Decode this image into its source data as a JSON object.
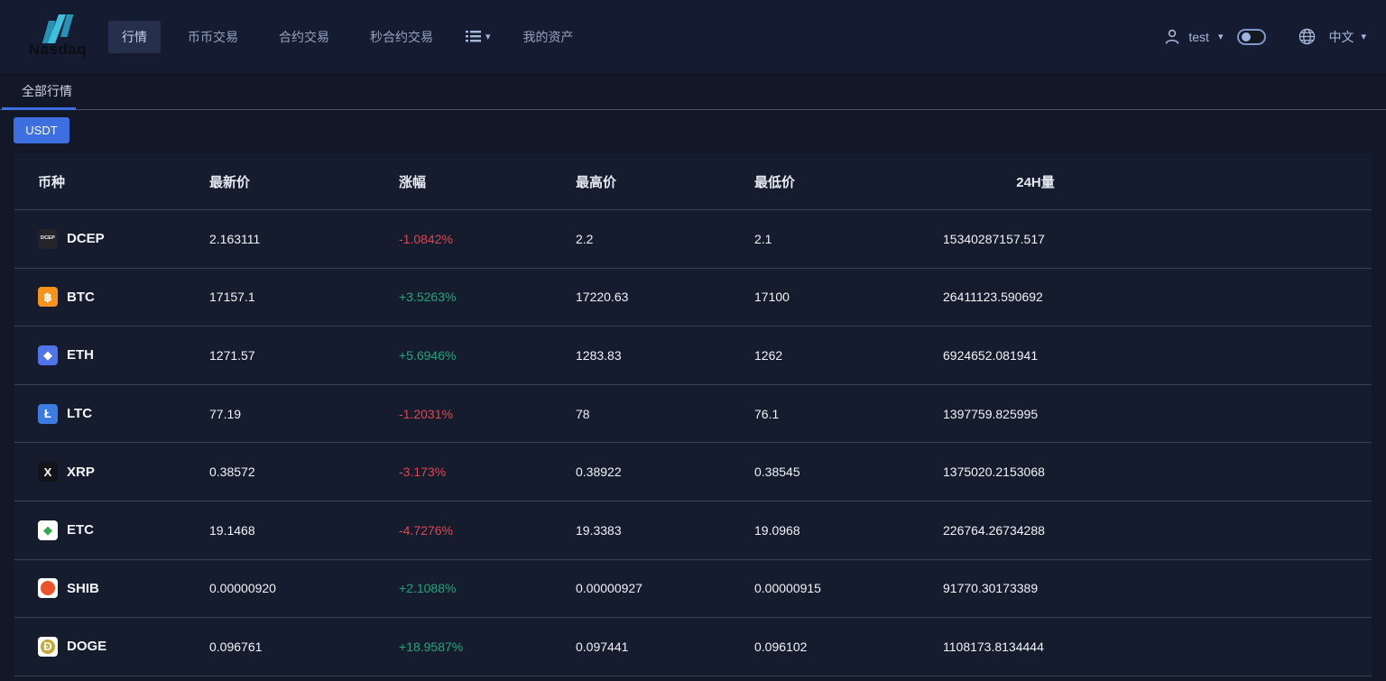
{
  "brand": {
    "name": "Nasdaq"
  },
  "navbar": {
    "items": [
      {
        "label": "行情",
        "active": true
      },
      {
        "label": "币币交易",
        "active": false
      },
      {
        "label": "合约交易",
        "active": false
      },
      {
        "label": "秒合约交易",
        "active": false
      },
      {
        "label": "我的资产",
        "active": false
      }
    ],
    "caret": "▾",
    "user": {
      "name": "test"
    },
    "language": "中文"
  },
  "tabs": {
    "active": "全部行情"
  },
  "filters": {
    "usdt_label": "USDT"
  },
  "market_table": {
    "columns": [
      "币种",
      "最新价",
      "涨幅",
      "最高价",
      "最低价",
      "24H量"
    ],
    "rows": [
      {
        "symbol": "DCEP",
        "last": "2.163111",
        "change": "-1.0842%",
        "direction": "down",
        "high": "2.2",
        "low": "2.1",
        "volume": "15340287157.517",
        "icon": {
          "bg": "#232329",
          "glyph": "DCEP",
          "fg": "#ffffff",
          "tiny": true
        }
      },
      {
        "symbol": "BTC",
        "last": "17157.1",
        "change": "+3.5263%",
        "direction": "up",
        "high": "17220.63",
        "low": "17100",
        "volume": "26411123.590692",
        "icon": {
          "bg": "#f7931a",
          "glyph": "฿",
          "fg": "#ffffff"
        }
      },
      {
        "symbol": "ETH",
        "last": "1271.57",
        "change": "+5.6946%",
        "direction": "up",
        "high": "1283.83",
        "low": "1262",
        "volume": "6924652.081941",
        "icon": {
          "bg": "#4f74e8",
          "glyph": "◆",
          "fg": "#ffffff"
        }
      },
      {
        "symbol": "LTC",
        "last": "77.19",
        "change": "-1.2031%",
        "direction": "down",
        "high": "78",
        "low": "76.1",
        "volume": "1397759.825995",
        "icon": {
          "bg": "#3c7ce0",
          "glyph": "Ł",
          "fg": "#ffffff"
        }
      },
      {
        "symbol": "XRP",
        "last": "0.38572",
        "change": "-3.173%",
        "direction": "down",
        "high": "0.38922",
        "low": "0.38545",
        "volume": "1375020.2153068",
        "icon": {
          "bg": "#121419",
          "glyph": "X",
          "fg": "#ffffff"
        }
      },
      {
        "symbol": "ETC",
        "last": "19.1468",
        "change": "-4.7276%",
        "direction": "down",
        "high": "19.3383",
        "low": "19.0968",
        "volume": "226764.26734288",
        "icon": {
          "bg": "#ffffff",
          "glyph": "◆",
          "fg": "#2faa4e"
        }
      },
      {
        "symbol": "SHIB",
        "last": "0.00000920",
        "change": "+2.1088%",
        "direction": "up",
        "high": "0.00000927",
        "low": "0.00000915",
        "volume": "91770.30173389",
        "icon": {
          "bg": "#ffffff",
          "glyph": "",
          "fg": "#f8c43c",
          "circle": "#f0512d"
        }
      },
      {
        "symbol": "DOGE",
        "last": "0.096761",
        "change": "+18.9587%",
        "direction": "up",
        "high": "0.097441",
        "low": "0.096102",
        "volume": "1108173.8134444",
        "icon": {
          "bg": "#ffffff",
          "glyph": "Ð",
          "fg": "#ffffff",
          "circle": "#c5a637"
        }
      }
    ]
  },
  "colors": {
    "up": "#21a67c",
    "down": "#e2454e",
    "accent": "#3d6fe0"
  }
}
